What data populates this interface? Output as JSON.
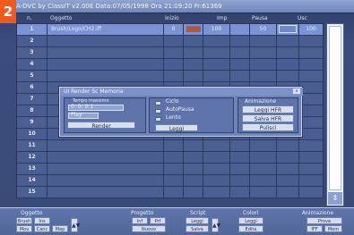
{
  "top": {
    "badge": "2",
    "title": "A-DVC by ClassIT v2.00E Data:07/05/1998 Ora 21:09:20 Fr:61369"
  },
  "table": {
    "headers": [
      "n.",
      "Oggetto",
      "Inizio",
      "Imp",
      "Pausa",
      "Usc"
    ],
    "rows": [
      {
        "num": "1",
        "obj": "Brush/Logo/CH2.iff",
        "i1": "0",
        "i2": "",
        "i3": "100",
        "i4": "",
        "i5": "50",
        "i6": "",
        "i7": "100",
        "selected": true
      },
      {
        "num": "2",
        "obj": "",
        "i1": "",
        "i2": "",
        "i3": "",
        "i4": "",
        "i5": "",
        "i6": "",
        "i7": "",
        "selected": false
      },
      {
        "num": "3",
        "obj": "",
        "i1": "",
        "i2": "",
        "i3": "",
        "i4": "",
        "i5": "",
        "i6": "",
        "i7": "",
        "selected": false
      },
      {
        "num": "4",
        "obj": "",
        "i1": "",
        "i2": "",
        "i3": "",
        "i4": "",
        "i5": "",
        "i6": "",
        "i7": "",
        "selected": false
      },
      {
        "num": "5",
        "obj": "",
        "i1": "",
        "i2": "",
        "i3": "",
        "i4": "",
        "i5": "",
        "i6": "",
        "i7": "",
        "selected": false
      },
      {
        "num": "6",
        "obj": "",
        "i1": "",
        "i2": "",
        "i3": "",
        "i4": "",
        "i5": "",
        "i6": "",
        "i7": "",
        "selected": false
      },
      {
        "num": "7",
        "obj": "",
        "i1": "",
        "i2": "",
        "i3": "",
        "i4": "",
        "i5": "",
        "i6": "",
        "i7": "",
        "selected": false
      },
      {
        "num": "8",
        "obj": "",
        "i1": "",
        "i2": "",
        "i3": "",
        "i4": "",
        "i5": "",
        "i6": "",
        "i7": "",
        "selected": false
      },
      {
        "num": "9",
        "obj": "",
        "i1": "",
        "i2": "",
        "i3": "",
        "i4": "",
        "i5": "",
        "i6": "",
        "i7": "",
        "selected": false
      },
      {
        "num": "10",
        "obj": "",
        "i1": "",
        "i2": "",
        "i3": "",
        "i4": "",
        "i5": "",
        "i6": "",
        "i7": "",
        "selected": false
      },
      {
        "num": "11",
        "obj": "",
        "i1": "",
        "i2": "",
        "i3": "",
        "i4": "",
        "i5": "",
        "i6": "",
        "i7": "",
        "selected": false
      },
      {
        "num": "12",
        "obj": "",
        "i1": "",
        "i2": "",
        "i3": "",
        "i4": "",
        "i5": "",
        "i6": "",
        "i7": "",
        "selected": false
      },
      {
        "num": "13",
        "obj": "",
        "i1": "",
        "i2": "",
        "i3": "",
        "i4": "",
        "i5": "",
        "i6": "",
        "i7": "",
        "selected": false
      },
      {
        "num": "14",
        "obj": "",
        "i1": "",
        "i2": "",
        "i3": "",
        "i4": "",
        "i5": "",
        "i6": "",
        "i7": "",
        "selected": false
      },
      {
        "num": "15",
        "obj": "",
        "i1": "",
        "i2": "",
        "i3": "",
        "i4": "",
        "i5": "",
        "i6": "",
        "i7": "",
        "selected": false
      }
    ]
  },
  "dialog": {
    "title": "UI Render Sc Memoria",
    "left_label": "Tempo massimo",
    "time_value": "0: 0: 0:1",
    "play": "Play",
    "render": "Render",
    "cycle": "Ciclo",
    "auto_pause": "AutoPausa",
    "slow": "Lento",
    "load": "Leggi",
    "animation_title": "Animazione",
    "btn_read_hfr": "Leggi HFR",
    "btn_save_hfr": "Salva HFR",
    "btn_clean": "Pulisci",
    "close": "x"
  },
  "bottom": {
    "groups": {
      "oggetto": "Oggetto",
      "progetto": "Progetto",
      "script": "Script",
      "colori": "Colori",
      "animazione": "Animazione"
    },
    "buttons": {
      "brush": "Brush",
      "inserisci": "Ins",
      "muovi": "Mov",
      "cancella": "Canc",
      "mappa": "Map",
      "inf": "Inf",
      "prf": "Prf",
      "nuovo": "Nuovo",
      "leggi_script": "Leggi",
      "salva_script": "Salva",
      "leggi_colori": "Leggi",
      "edita": "Edita",
      "prova": "Prova",
      "iff": "IFF",
      "mem": "Mem"
    }
  },
  "colors": {
    "badge": "#ef5a1f",
    "grid": "#4a5d90",
    "selected_row": "#7b93d2"
  }
}
